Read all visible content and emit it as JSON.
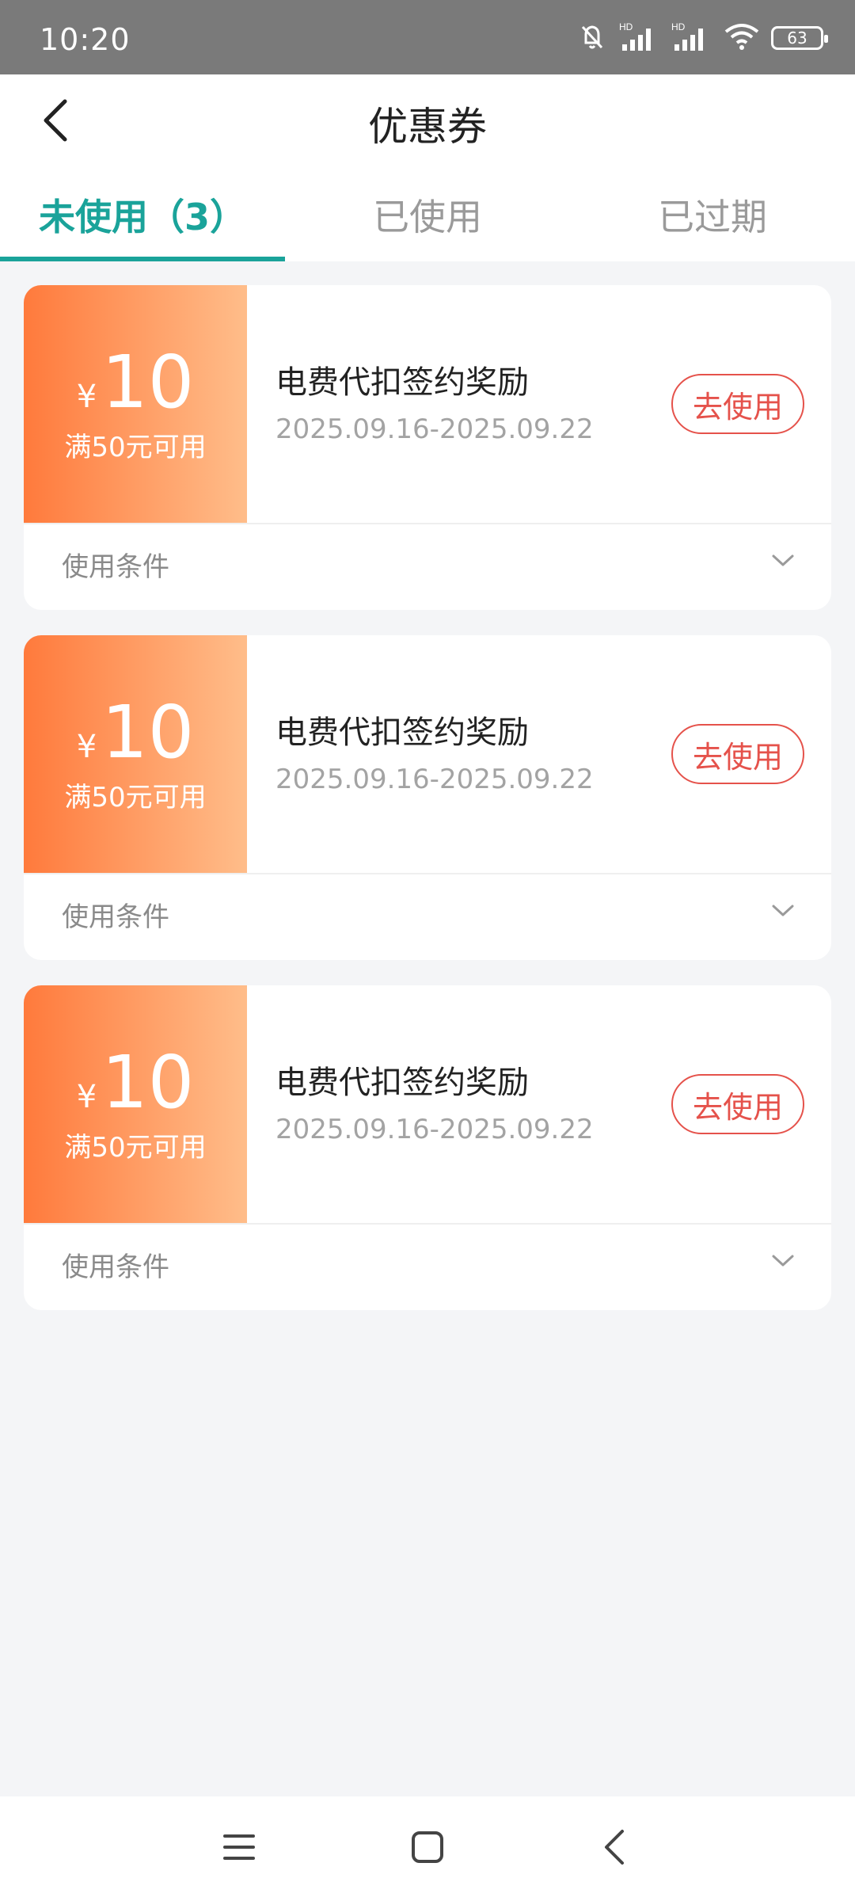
{
  "status": {
    "time": "10:20",
    "battery": "63"
  },
  "header": {
    "title": "优惠券"
  },
  "tabs": [
    {
      "label": "未使用（3）"
    },
    {
      "label": "已使用"
    },
    {
      "label": "已过期"
    }
  ],
  "coupons": [
    {
      "currency": "¥",
      "amount": "10",
      "condition": "满50元可用",
      "name": "电费代扣签约奖励",
      "date": "2025.09.16-2025.09.22",
      "button": "去使用",
      "terms_label": "使用条件"
    },
    {
      "currency": "¥",
      "amount": "10",
      "condition": "满50元可用",
      "name": "电费代扣签约奖励",
      "date": "2025.09.16-2025.09.22",
      "button": "去使用",
      "terms_label": "使用条件"
    },
    {
      "currency": "¥",
      "amount": "10",
      "condition": "满50元可用",
      "name": "电费代扣签约奖励",
      "date": "2025.09.16-2025.09.22",
      "button": "去使用",
      "terms_label": "使用条件"
    }
  ],
  "colors": {
    "accent": "#1aa39a",
    "coupon_gradient_start": "#ff7a3c",
    "coupon_gradient_end": "#ffbd8a",
    "button": "#e5524b"
  },
  "icons": {
    "back": "back-arrow-icon",
    "menu": "menu-icon",
    "home": "home-square-icon",
    "nav_back": "nav-back-icon"
  }
}
